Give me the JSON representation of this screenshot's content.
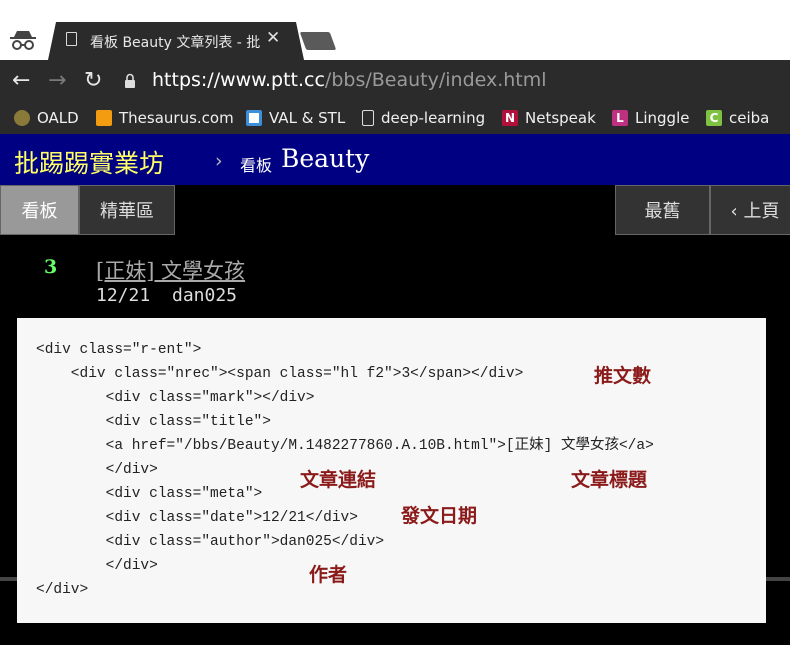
{
  "browser": {
    "tab": {
      "title": "看板 Beauty 文章列表 - 批",
      "close": "✕"
    },
    "nav": {
      "back": "←",
      "forward": "→",
      "reload": "↻"
    },
    "url": {
      "host": "https://www.ptt.cc",
      "path": "/bbs/Beauty/index.html"
    },
    "bookmarks": [
      {
        "label": "OALD",
        "icon": "oald-icon",
        "color": "#8a7a3a"
      },
      {
        "label": "Thesaurus.com",
        "icon": "thesaurus-icon",
        "color": "#f39c12"
      },
      {
        "label": "VAL & STL",
        "icon": "grid-icon",
        "color": "#3d8fd9"
      },
      {
        "label": "deep-learning",
        "icon": "page-icon",
        "color": "#2b2b2b"
      },
      {
        "label": "Netspeak",
        "icon": "netspeak-icon",
        "color": "#b0103a"
      },
      {
        "label": "Linggle",
        "icon": "linggle-icon",
        "color": "#c03080"
      },
      {
        "label": "ceiba",
        "icon": "ceiba-icon",
        "color": "#7fc241"
      }
    ]
  },
  "ptt": {
    "logo": "批踢踢實業坊",
    "crumb_sep": "›",
    "board_label": "看板",
    "board": "Beauty",
    "buttons": {
      "board": "看板",
      "digest": "精華區",
      "oldest": "最舊",
      "prev": "‹ 上頁"
    },
    "entry": {
      "nrec": "3",
      "title": "[正妹] 文學女孩",
      "date": "12/21",
      "author": "dan025"
    }
  },
  "code": {
    "lines": [
      "<div class=\"r-ent\">",
      "    <div class=\"nrec\"><span class=\"hl f2\">3</span></div>",
      "        <div class=\"mark\"></div>",
      "        <div class=\"title\">",
      "        <a href=\"/bbs/Beauty/M.1482277860.A.10B.html\">[正妹] 文學女孩</a>",
      "        </div>",
      "        <div class=\"meta\">",
      "        <div class=\"date\">12/21</div>",
      "        <div class=\"author\">dan025</div>",
      "        </div>",
      "</div>"
    ],
    "annotations": {
      "nrec": "推文數",
      "link": "文章連結",
      "title": "文章標題",
      "date": "發文日期",
      "author": "作者"
    }
  }
}
